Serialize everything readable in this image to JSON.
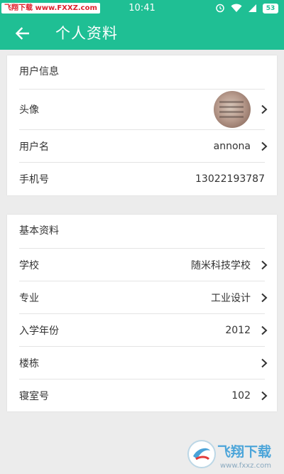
{
  "status_bar": {
    "watermark": "飞翔下载 www.FXXZ.com",
    "time": "10:41",
    "battery": "53"
  },
  "header": {
    "title": "个人资料"
  },
  "user_info": {
    "section_title": "用户信息",
    "rows": [
      {
        "label": "头像",
        "value": ""
      },
      {
        "label": "用户名",
        "value": "annona"
      },
      {
        "label": "手机号",
        "value": "13022193787"
      }
    ]
  },
  "basic_info": {
    "section_title": "基本资料",
    "rows": [
      {
        "label": "学校",
        "value": "随米科技学校"
      },
      {
        "label": "专业",
        "value": "工业设计"
      },
      {
        "label": "入学年份",
        "value": "2012"
      },
      {
        "label": "楼栋",
        "value": ""
      },
      {
        "label": "寝室号",
        "value": "102"
      }
    ]
  },
  "watermark_logo": {
    "text": "飞翔下载",
    "url": "www.fxxz.com"
  },
  "colors": {
    "accent": "#1fbf94",
    "background": "#ececec"
  }
}
